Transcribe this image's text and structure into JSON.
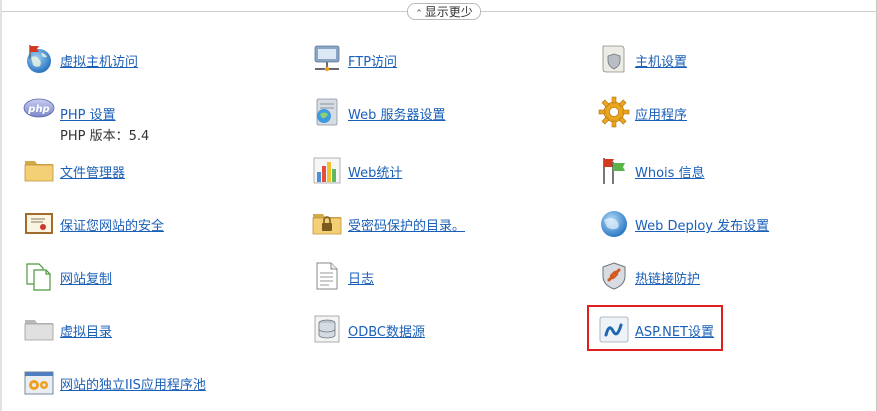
{
  "toggle": {
    "arrow": "⌃",
    "label": "显示更少"
  },
  "items": [
    {
      "label": "虚拟主机访问",
      "icon": "globe-flag-icon"
    },
    {
      "label": "FTP访问",
      "icon": "ftp-server-icon"
    },
    {
      "label": "主机设置",
      "icon": "document-shield-icon"
    },
    {
      "label": "PHP 设置",
      "sub": "PHP 版本：5.4",
      "icon": "php-icon"
    },
    {
      "label": "Web 服务器设置",
      "icon": "web-server-icon"
    },
    {
      "label": "应用程序",
      "icon": "gear-icon"
    },
    {
      "label": "文件管理器",
      "icon": "folder-icon"
    },
    {
      "label": "Web统计",
      "icon": "bar-chart-icon"
    },
    {
      "label": "Whois 信息",
      "icon": "flags-icon"
    },
    {
      "label": "保证您网站的安全",
      "icon": "certificate-icon"
    },
    {
      "label": "受密码保护的目录。",
      "icon": "locked-folder-icon"
    },
    {
      "label": "Web Deploy 发布设置",
      "icon": "web-deploy-icon"
    },
    {
      "label": "网站复制",
      "icon": "copy-pages-icon"
    },
    {
      "label": "日志",
      "icon": "log-file-icon"
    },
    {
      "label": "热链接防护",
      "icon": "hotlink-shield-icon"
    },
    {
      "label": "虚拟目录",
      "icon": "virtual-folder-icon"
    },
    {
      "label": "ODBC数据源",
      "icon": "database-icon"
    },
    {
      "label": "ASP.NET设置",
      "icon": "aspnet-icon"
    },
    {
      "label": "网站的独立IIS应用程序池",
      "icon": "app-pool-icon"
    }
  ]
}
